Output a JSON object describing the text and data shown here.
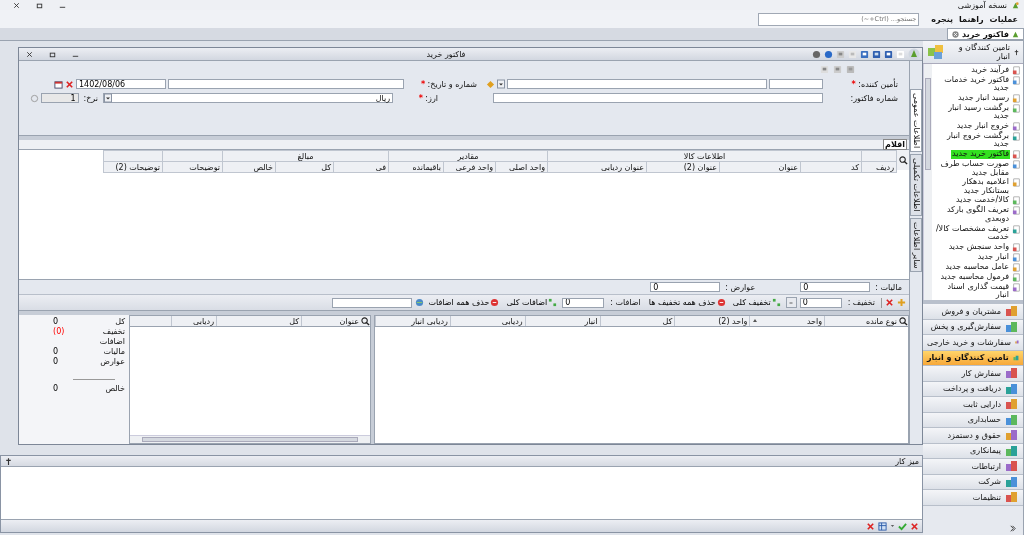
{
  "app_title": "نسخه آموزشی",
  "menu": [
    {
      "label": "عملیات"
    },
    {
      "label": "راهنما"
    },
    {
      "label": "پنجره"
    }
  ],
  "search": {
    "placeholder": "جستجو... (Ctrl+~)"
  },
  "doc_tabs": [
    {
      "label": "فاکتور خرید",
      "selected": true
    }
  ],
  "document": {
    "title": "فاکتور خرید",
    "side_tabs": [
      {
        "label": "اطلاعات عمومی",
        "selected": true
      },
      {
        "label": "اطلاعات تکمیلی",
        "selected": false
      },
      {
        "label": "سایر اطلاعات",
        "selected": false
      }
    ],
    "form": {
      "supplier": {
        "label": "تأمین کننده:",
        "required_mark": "*"
      },
      "number_date": {
        "label": "شماره و تاریخ:",
        "required_mark": "*",
        "date": "1402/08/06"
      },
      "invoice_number": {
        "label": "شماره فاکتور:"
      },
      "currency": {
        "label": "ارز:",
        "required_mark": "*",
        "value": "ریال"
      },
      "rate": {
        "label": "نرخ:",
        "value": "1"
      }
    },
    "items": {
      "title": "اقلام",
      "columns": [
        {
          "label": "ردیف"
        },
        {
          "group": "اطلاعات کالا",
          "columns": [
            {
              "label": "کد"
            },
            {
              "label": "عنوان"
            },
            {
              "label": "عنوان (2)"
            },
            {
              "label": "عنوان ردیابی"
            }
          ]
        },
        {
          "group": "مقادیر",
          "columns": [
            {
              "label": "واحد اصلی"
            },
            {
              "label": "واحد فرعی"
            },
            {
              "label": "باقیمانده"
            }
          ]
        },
        {
          "group": "مبالغ",
          "columns": [
            {
              "label": "فی"
            },
            {
              "label": "کل"
            },
            {
              "label": "خالص"
            }
          ]
        },
        {
          "label": "توضیحات"
        },
        {
          "label": "توضیحات (2)"
        }
      ]
    },
    "footer": [
      {
        "label": "مالیات :",
        "value": "0"
      },
      {
        "label": "عوارض :",
        "value": "0"
      }
    ],
    "toolbar": {
      "discount": {
        "label": "تخفیف :",
        "value": "0"
      },
      "discount_all": "تخفیف کلی",
      "remove_discounts": "حذف همه تخفیف ها",
      "additions": {
        "label": "اضافات :",
        "value": "0"
      },
      "additions_all": "اضافات کلی",
      "remove_additions": "حذف همه اضافات"
    },
    "stock_grid": {
      "columns": [
        "نوع مانده",
        "واحد",
        "واحد (2)",
        "کل",
        "انبار",
        "ردیابی",
        "ردیابی انبار"
      ]
    },
    "tracking_grid": {
      "columns": [
        "عنوان",
        "کل",
        "ردیابی"
      ]
    },
    "summary": {
      "rows": [
        {
          "label": "کل",
          "value": "0",
          "kind": "plain"
        },
        {
          "label": "تخفیف",
          "value": "(0)",
          "kind": "deduction"
        },
        {
          "label": "اضافات"
        },
        {
          "label": "مالیات",
          "value": "0",
          "kind": "plain"
        },
        {
          "label": "عوارض",
          "value": "0",
          "kind": "plain"
        }
      ],
      "total": {
        "label": "خالص",
        "value": "0"
      }
    }
  },
  "workspace": {
    "title": "میز کار"
  },
  "sidebar": {
    "title": "تامین کنندگان و انبار",
    "items": [
      {
        "label": "فرآیند خرید",
        "selected": false
      },
      {
        "label": "فاکتور خرید خدمات جدید",
        "selected": false
      },
      {
        "label": "رسید انبار جدید",
        "selected": false
      },
      {
        "label": "برگشت رسید انبار جدید",
        "selected": false
      },
      {
        "label": "خروج انبار جدید",
        "selected": false
      },
      {
        "label": "برگشت خروج انبار جدید",
        "selected": false
      },
      {
        "label": "فاکتور خرید جدید",
        "selected": true
      },
      {
        "label": "صورت حساب طرف مقابل جدید",
        "selected": false
      },
      {
        "label": "اعلامیه بدهکار بستانکار جدید",
        "selected": false
      },
      {
        "label": "کالا/خدمت جدید",
        "selected": false
      },
      {
        "label": "تعریف الگوی بارکد دوبعدی",
        "selected": false
      },
      {
        "label": "تعریف مشخصات کالا/خدمت",
        "selected": false
      },
      {
        "label": "واحد سنجش جدید",
        "selected": false
      },
      {
        "label": "انبار جدید",
        "selected": false
      },
      {
        "label": "عامل محاسبه جدید",
        "selected": false
      },
      {
        "label": "فرمول محاسبه جدید",
        "selected": false
      },
      {
        "label": "قیمت گذاری اسناد انبار",
        "selected": false
      }
    ],
    "modules": [
      {
        "label": "مشتریان و فروش",
        "selected": false
      },
      {
        "label": "سفارش‌گیری و پخش",
        "selected": false
      },
      {
        "label": "سفارشات و خرید خارجی",
        "selected": false
      },
      {
        "label": "تامین کنندگان و انبار",
        "selected": true
      },
      {
        "label": "سفارش کار",
        "selected": false
      },
      {
        "label": "دریافت و پرداخت",
        "selected": false
      },
      {
        "label": "دارایی ثابت",
        "selected": false
      },
      {
        "label": "حسابداری",
        "selected": false
      },
      {
        "label": "حقوق و دستمزد",
        "selected": false
      },
      {
        "label": "پیمانکاری",
        "selected": false
      },
      {
        "label": "ارتباطات",
        "selected": false
      },
      {
        "label": "شرکت",
        "selected": false
      },
      {
        "label": "تنظیمات",
        "selected": false
      }
    ]
  }
}
